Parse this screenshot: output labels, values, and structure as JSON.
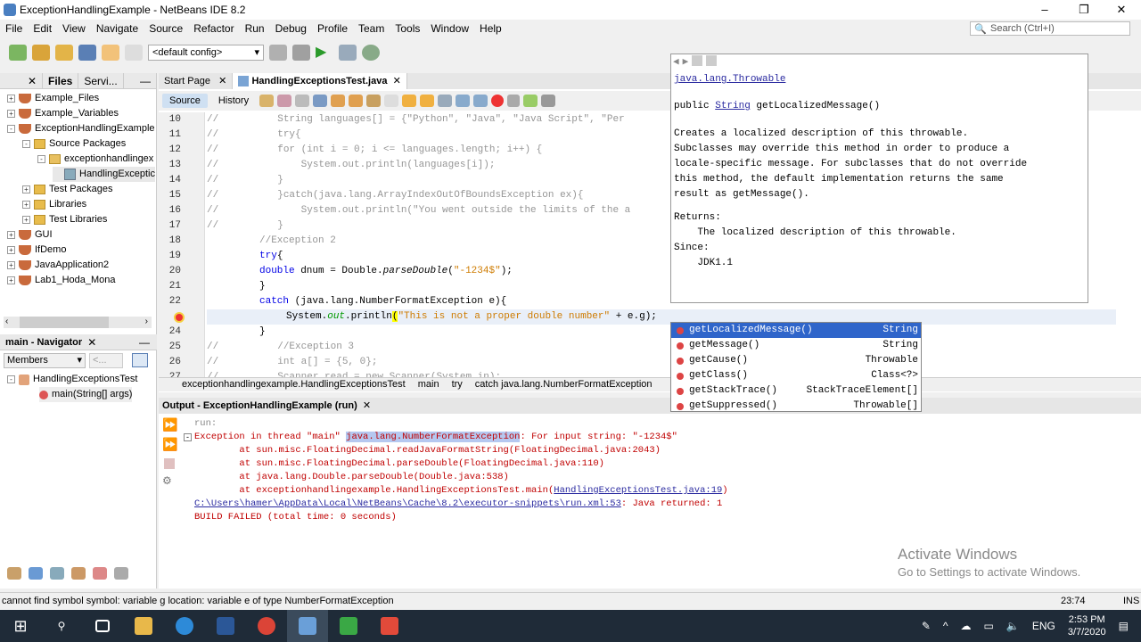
{
  "window": {
    "title": "ExceptionHandlingExample - NetBeans IDE 8.2"
  },
  "menu": [
    "File",
    "Edit",
    "View",
    "Navigate",
    "Source",
    "Refactor",
    "Run",
    "Debug",
    "Profile",
    "Team",
    "Tools",
    "Window",
    "Help"
  ],
  "search": {
    "placeholder": "Search (Ctrl+I)"
  },
  "toolbar": {
    "config": "<default config>"
  },
  "projects": {
    "tabs": [
      "Files",
      "Servi..."
    ],
    "tree": [
      {
        "label": "Example_Files",
        "level": 0,
        "kind": "project",
        "exp": "+"
      },
      {
        "label": "Example_Variables",
        "level": 0,
        "kind": "project",
        "exp": "+"
      },
      {
        "label": "ExceptionHandlingExample",
        "level": 0,
        "kind": "project",
        "exp": "-"
      },
      {
        "label": "Source Packages",
        "level": 1,
        "kind": "folder",
        "exp": "-"
      },
      {
        "label": "exceptionhandlingex",
        "level": 2,
        "kind": "package",
        "exp": "-"
      },
      {
        "label": "HandlingExceptic",
        "level": 3,
        "kind": "file",
        "exp": ""
      },
      {
        "label": "Test Packages",
        "level": 1,
        "kind": "folder",
        "exp": "+"
      },
      {
        "label": "Libraries",
        "level": 1,
        "kind": "folder",
        "exp": "+"
      },
      {
        "label": "Test Libraries",
        "level": 1,
        "kind": "folder",
        "exp": "+"
      },
      {
        "label": "GUI",
        "level": 0,
        "kind": "project",
        "exp": "+"
      },
      {
        "label": "IfDemo",
        "level": 0,
        "kind": "project",
        "exp": "+"
      },
      {
        "label": "JavaApplication2",
        "level": 0,
        "kind": "project",
        "exp": "+"
      },
      {
        "label": "Lab1_Hoda_Mona",
        "level": 0,
        "kind": "project",
        "exp": "+"
      }
    ]
  },
  "navigator": {
    "title": "main - Navigator",
    "filter": "Members",
    "filter2": "<...",
    "items": [
      "HandlingExceptionsTest",
      "main(String[] args)"
    ]
  },
  "editor": {
    "tabs": [
      "Start Page",
      "HandlingExceptionsTest.java"
    ],
    "modes": [
      "Source",
      "History"
    ],
    "lines": [
      {
        "n": "10",
        "indent": 0,
        "segs": [
          {
            "t": "//          String languages[] = {\"Python\", \"Java\", \"Java Script\", \"Per",
            "c": "cm"
          }
        ]
      },
      {
        "n": "11",
        "indent": 0,
        "segs": [
          {
            "t": "//          try{",
            "c": "cm"
          }
        ]
      },
      {
        "n": "12",
        "indent": 0,
        "segs": [
          {
            "t": "//          for (int i = 0; i <= languages.length; i++) {",
            "c": "cm"
          }
        ]
      },
      {
        "n": "13",
        "indent": 0,
        "segs": [
          {
            "t": "//              System.out.println(languages[i]);",
            "c": "cm"
          }
        ]
      },
      {
        "n": "14",
        "indent": 0,
        "segs": [
          {
            "t": "//          }",
            "c": "cm"
          }
        ]
      },
      {
        "n": "15",
        "indent": 0,
        "segs": [
          {
            "t": "//          }catch(java.lang.ArrayIndexOutOfBoundsException ex){",
            "c": "cm"
          }
        ]
      },
      {
        "n": "16",
        "indent": 0,
        "segs": [
          {
            "t": "//              System.out.println(\"You went outside the limits of the a",
            "c": "cm"
          }
        ]
      },
      {
        "n": "17",
        "indent": 0,
        "segs": [
          {
            "t": "//          }",
            "c": "cm"
          }
        ]
      },
      {
        "n": "18",
        "indent": 1,
        "segs": [
          {
            "t": "//Exception 2",
            "c": "cm"
          }
        ]
      },
      {
        "n": "19",
        "indent": 1,
        "segs": [
          {
            "t": "try",
            "c": "kw"
          },
          {
            "t": "{",
            "c": "n"
          }
        ]
      },
      {
        "n": "20",
        "indent": 1,
        "segs": [
          {
            "t": "double",
            "c": "kw"
          },
          {
            "t": " dnum = Double.",
            "c": "n"
          },
          {
            "t": "parseDouble",
            "c": "it"
          },
          {
            "t": "(",
            "c": "n"
          },
          {
            "t": "\"-1234$\"",
            "c": "str"
          },
          {
            "t": ");",
            "c": "n"
          }
        ]
      },
      {
        "n": "21",
        "indent": 1,
        "segs": [
          {
            "t": "}",
            "c": "n"
          }
        ]
      },
      {
        "n": "22",
        "indent": 1,
        "segs": [
          {
            "t": "catch",
            "c": "kw"
          },
          {
            "t": " (java.lang.NumberFormatException e){",
            "c": "n"
          }
        ]
      },
      {
        "n": "23",
        "indent": 2,
        "segs": [
          {
            "t": "System.",
            "c": "n"
          },
          {
            "t": "out",
            "c": "fld"
          },
          {
            "t": ".println",
            "c": "n"
          },
          {
            "t": "(",
            "c": "hl"
          },
          {
            "t": "\"This is not a proper double number\"",
            "c": "str"
          },
          {
            "t": " + e.g);",
            "c": "n"
          }
        ]
      },
      {
        "n": "24",
        "indent": 1,
        "segs": [
          {
            "t": "}",
            "c": "n"
          }
        ]
      },
      {
        "n": "25",
        "indent": 0,
        "segs": [
          {
            "t": "//          //Exception 3",
            "c": "cm"
          }
        ]
      },
      {
        "n": "26",
        "indent": 0,
        "segs": [
          {
            "t": "//          int a[] = {5, 0};",
            "c": "cm"
          }
        ]
      },
      {
        "n": "27",
        "indent": 0,
        "segs": [
          {
            "t": "//          Scanner read = new Scanner(System.in);",
            "c": "cm"
          }
        ]
      }
    ],
    "breadcrumb": [
      "exceptionhandlingexample.HandlingExceptionsTest",
      "main",
      "try",
      "catch java.lang.NumberFormatException"
    ]
  },
  "javadoc": {
    "class": "java.lang.Throwable",
    "sig_prefix": "public ",
    "sig_type": "String",
    "sig_rest": " getLocalizedMessage()",
    "desc": "Creates a localized description of this throwable.\nSubclasses may override this method in order to produce a\nlocale-specific message. For subclasses that do not override\nthis method, the default implementation returns the same\nresult as getMessage().",
    "returns_label": "Returns:",
    "returns": "    The localized description of this throwable.",
    "since_label": "Since:",
    "since": "    JDK1.1"
  },
  "completion": [
    {
      "name": "getLocalizedMessage()",
      "type": "String"
    },
    {
      "name": "getMessage()",
      "type": "String"
    },
    {
      "name": "getCause()",
      "type": "Throwable"
    },
    {
      "name": "getClass()",
      "type": "Class<?>"
    },
    {
      "name": "getStackTrace()",
      "type": "StackTraceElement[]"
    },
    {
      "name": "getSuppressed()",
      "type": "Throwable[]"
    }
  ],
  "output": {
    "title": "Output - ExceptionHandlingExample (run)",
    "run": "run:",
    "exc_prefix": "Exception in thread \"main\" ",
    "exc_class": "java.lang.NumberFormatException",
    "exc_suffix": ": For input string: \"-1234$\"",
    "trace": [
      "        at sun.misc.FloatingDecimal.readJavaFormatString(FloatingDecimal.java:2043)",
      "        at sun.misc.FloatingDecimal.parseDouble(FloatingDecimal.java:110)",
      "        at java.lang.Double.parseDouble(Double.java:538)"
    ],
    "trace4_prefix": "        at exceptionhandlingexample.HandlingExceptionsTest.main(",
    "trace4_link": "HandlingExceptionsTest.java:19",
    "trace4_suffix": ")",
    "path_link": "C:\\Users\\hamer\\AppData\\Local\\NetBeans\\Cache\\8.2\\executor-snippets\\run.xml:53",
    "path_suffix": ": Java returned: 1",
    "build": "BUILD FAILED (total time: 0 seconds)"
  },
  "status": {
    "message": "cannot find symbol  symbol: variable g  location: variable e of type NumberFormatException",
    "position": "23:74",
    "mode": "INS"
  },
  "watermark": {
    "title": "Activate Windows",
    "sub": "Go to Settings to activate Windows."
  },
  "taskbar": {
    "time": "2:53 PM",
    "date": "3/7/2020",
    "lang": "ENG"
  }
}
